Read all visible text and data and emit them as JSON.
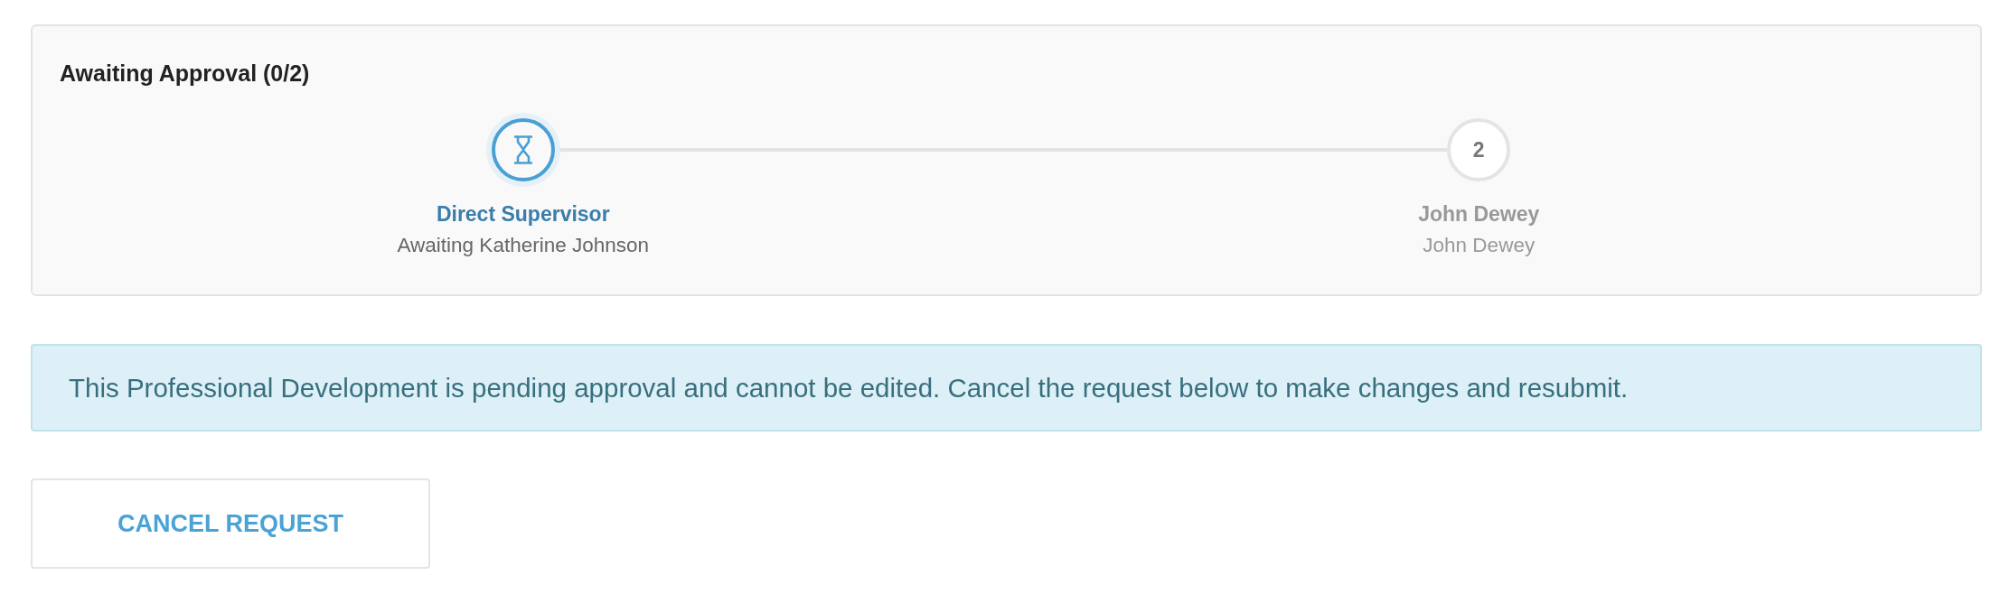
{
  "approval_panel": {
    "title": "Awaiting Approval (0/2)",
    "steps": [
      {
        "kind": "current",
        "name": "Direct Supervisor",
        "detail": "Awaiting Katherine Johnson"
      },
      {
        "kind": "upcoming",
        "number": "2",
        "name": "John Dewey",
        "detail": "John Dewey"
      }
    ]
  },
  "alert": {
    "message": "This Professional Development is pending approval and cannot be edited. Cancel the request below to make changes and resubmit."
  },
  "buttons": [
    "CANCEL REQUEST"
  ]
}
